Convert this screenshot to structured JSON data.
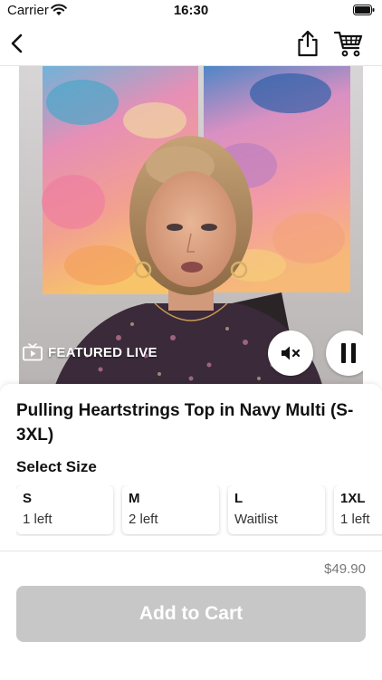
{
  "status_bar": {
    "carrier": "Carrier",
    "time": "16:30"
  },
  "nav": {
    "back_icon": "chevron-left-icon",
    "share_icon": "share-icon",
    "cart_icon": "cart-icon"
  },
  "video": {
    "badge_label": "FEATURED LIVE",
    "badge_icon": "tv-play-icon",
    "mute_icon": "speaker-muted-icon",
    "pause_icon": "pause-icon"
  },
  "product": {
    "title": "Pulling Heartstrings Top in Navy Multi (S-3XL)",
    "select_size_label": "Select Size",
    "sizes": [
      {
        "name": "S",
        "availability": "1 left"
      },
      {
        "name": "M",
        "availability": "2 left"
      },
      {
        "name": "L",
        "availability": "Waitlist"
      },
      {
        "name": "1XL",
        "availability": "1 left"
      }
    ]
  },
  "footer": {
    "price": "$49.90",
    "add_to_cart_label": "Add to Cart"
  },
  "colors": {
    "button_disabled": "#c7c7c7",
    "price_text": "#777777"
  }
}
